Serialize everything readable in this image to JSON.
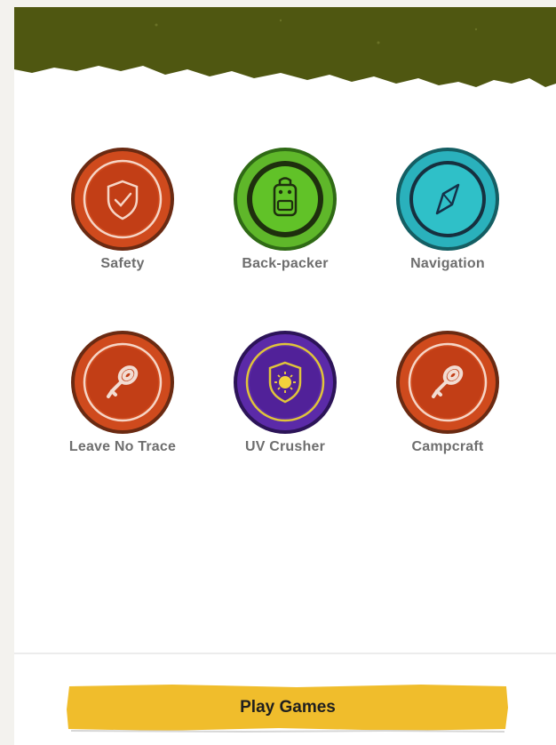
{
  "app": {
    "accent_header": "#4f5711",
    "accent_button": "#f0bd2c"
  },
  "badges": [
    {
      "label": "Safety",
      "icon": "shield-check-icon",
      "color": "#cf4a1d"
    },
    {
      "label": "Back-packer",
      "icon": "backpack-icon",
      "color": "#5fb72a"
    },
    {
      "label": "Navigation",
      "icon": "compass-icon",
      "color": "#2ab1bc"
    },
    {
      "label": "Leave No Trace",
      "icon": "rope-icon",
      "color": "#cf4a1d"
    },
    {
      "label": "UV Crusher",
      "icon": "sun-shield-icon",
      "color": "#5b2aa8"
    },
    {
      "label": "Campcraft",
      "icon": "rope-icon",
      "color": "#cf4a1d"
    }
  ],
  "footer": {
    "play_button_label": "Play Games"
  }
}
